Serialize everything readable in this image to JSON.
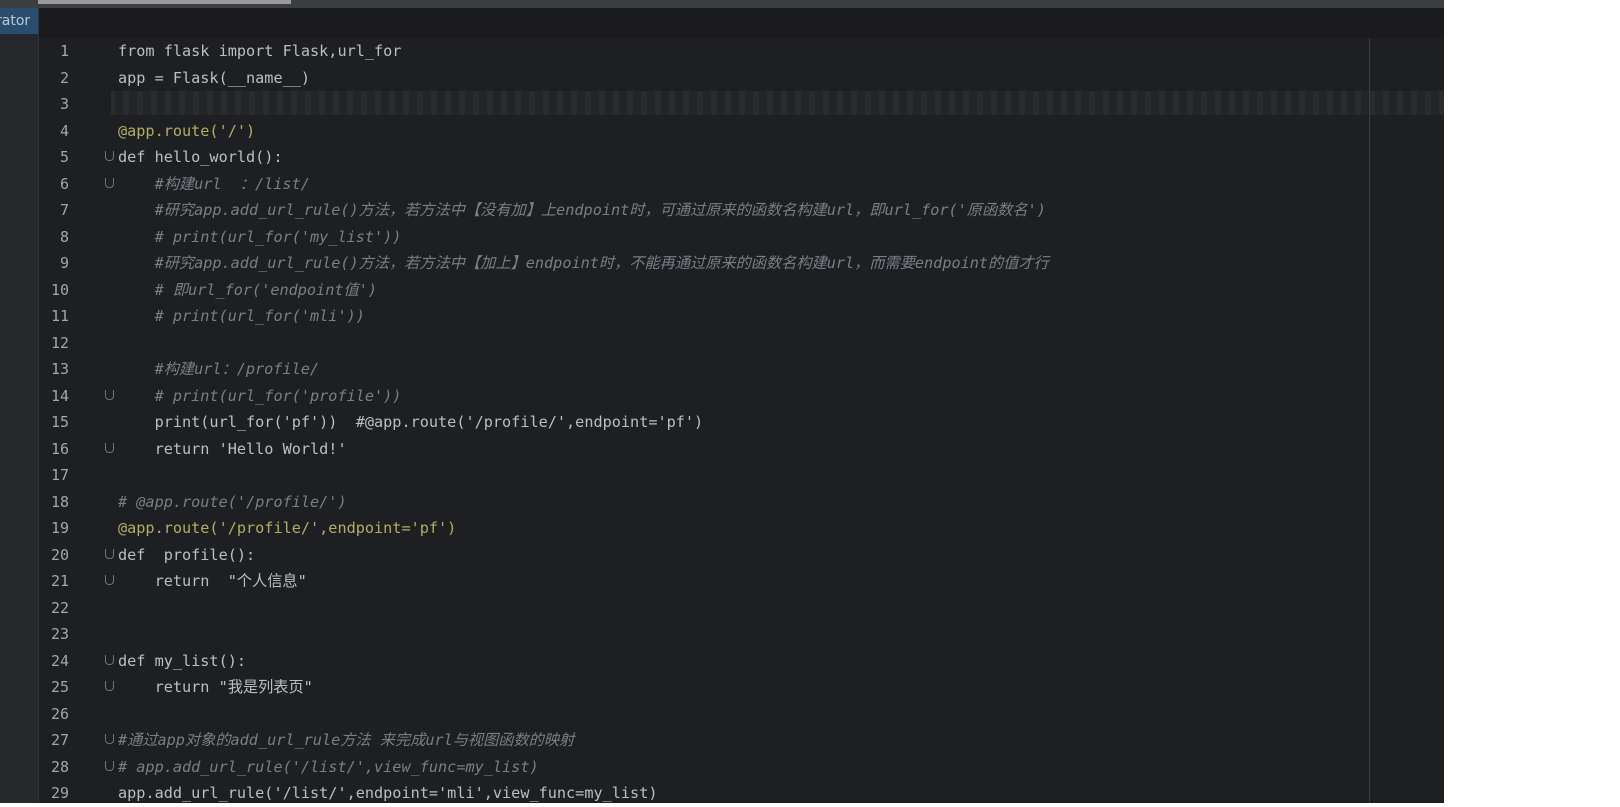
{
  "sidebar": {
    "tab_label": "rator"
  },
  "editor": {
    "lines": [
      {
        "n": "1",
        "text": "from flask import Flask,url_for"
      },
      {
        "n": "2",
        "text": "app = Flask(__name__)"
      },
      {
        "n": "3",
        "text": ""
      },
      {
        "n": "4",
        "text": "@app.route('/')"
      },
      {
        "n": "5",
        "text": "def hello_world():"
      },
      {
        "n": "6",
        "text": "    #构建url  ：/list/"
      },
      {
        "n": "7",
        "text": "    #研究app.add_url_rule()方法，若方法中【没有加】上endpoint时，可通过原来的函数名构建url，即url_for('原函数名')"
      },
      {
        "n": "8",
        "text": "    # print(url_for('my_list'))"
      },
      {
        "n": "9",
        "text": "    #研究app.add_url_rule()方法，若方法中【加上】endpoint时，不能再通过原来的函数名构建url，而需要endpoint的值才行"
      },
      {
        "n": "10",
        "text": "    # 即url_for('endpoint值')"
      },
      {
        "n": "11",
        "text": "    # print(url_for('mli'))"
      },
      {
        "n": "12",
        "text": ""
      },
      {
        "n": "13",
        "text": "    #构建url：/profile/"
      },
      {
        "n": "14",
        "text": "    # print(url_for('profile'))"
      },
      {
        "n": "15",
        "text": "    print(url_for('pf'))  #@app.route('/profile/',endpoint='pf')"
      },
      {
        "n": "16",
        "text": "    return 'Hello World!'"
      },
      {
        "n": "17",
        "text": ""
      },
      {
        "n": "18",
        "text": "# @app.route('/profile/')"
      },
      {
        "n": "19",
        "text": "@app.route('/profile/',endpoint='pf')"
      },
      {
        "n": "20",
        "text": "def  profile():"
      },
      {
        "n": "21",
        "text": "    return  \"个人信息\""
      },
      {
        "n": "22",
        "text": ""
      },
      {
        "n": "23",
        "text": ""
      },
      {
        "n": "24",
        "text": "def my_list():"
      },
      {
        "n": "25",
        "text": "    return \"我是列表页\""
      },
      {
        "n": "26",
        "text": ""
      },
      {
        "n": "27",
        "text": "#通过app对象的add_url_rule方法 来完成url与视图函数的映射"
      },
      {
        "n": "28",
        "text": "# app.add_url_rule('/list/',view_func=my_list)"
      },
      {
        "n": "29",
        "text": "app.add_url_rule('/list/',endpoint='mli',view_func=my_list)"
      }
    ]
  },
  "colors": {
    "editor_bg": "#1e1f22",
    "keyword": "#cf8e6d",
    "string": "#6aab73",
    "comment": "#7a7e85",
    "decorator": "#b3ae60",
    "parameter": "#d5764b",
    "line_number": "#a3a6ab"
  },
  "folds": [
    "5",
    "6",
    "14",
    "16",
    "20",
    "21",
    "24",
    "25",
    "27",
    "28"
  ]
}
